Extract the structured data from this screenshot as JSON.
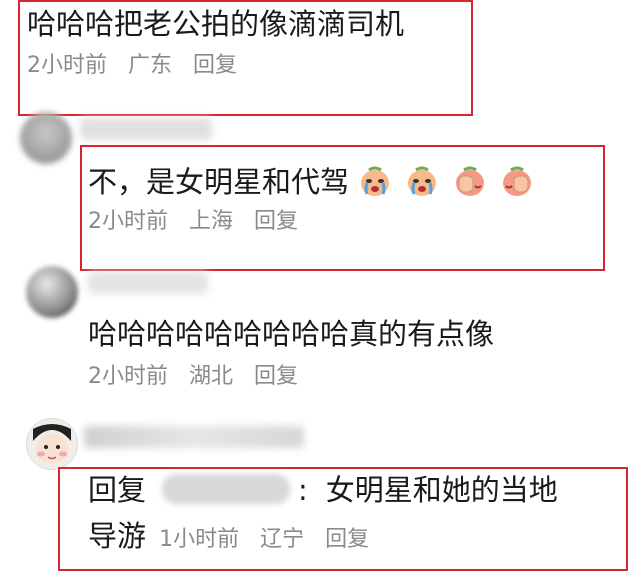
{
  "comments": [
    {
      "text": "哈哈哈把老公拍的像滴滴司机",
      "time": "2小时前",
      "location": "广东",
      "reply_label": "回复"
    },
    {
      "text": "不，是女明星和代驾",
      "emojis": [
        "crying-face-emoji",
        "crying-face-emoji",
        "facepalm-emoji",
        "facepalm-emoji"
      ],
      "time": "2小时前",
      "location": "上海",
      "reply_label": "回复"
    },
    {
      "text": "哈哈哈哈哈哈哈哈哈真的有点像",
      "time": "2小时前",
      "location": "湖北",
      "reply_label": "回复"
    },
    {
      "reply_prefix": "回复",
      "separator": ":",
      "text_line1": "女明星和她的当地",
      "text_line2": "导游",
      "time": "1小时前",
      "location": "辽宁",
      "reply_label": "回复"
    }
  ],
  "colors": {
    "highlight_box": "#d9262c",
    "meta_text": "#8a8a8a",
    "body_text": "#1a1a1a"
  }
}
